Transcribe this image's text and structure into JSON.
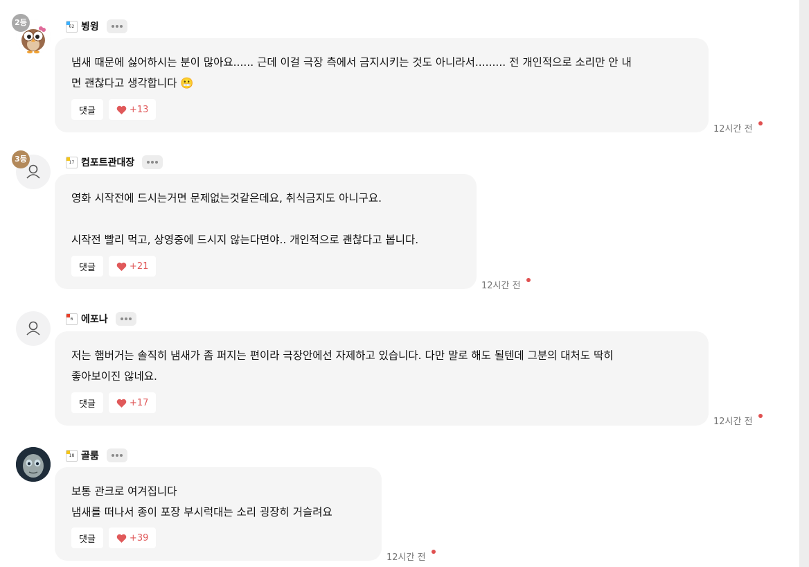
{
  "comments": [
    {
      "rank": "2등",
      "level": "62",
      "level_color": "#3ab0ff",
      "nickname": "뷩윙",
      "avatar": "owl-avatar",
      "text": "냄새 때문에 싫어하시는 분이 많아요...... 근데 이걸 극장 측에서 금지시키는 것도 아니라서......... 전 개인적으로 소리만 안 내\n면 괜찮다고 생각합니다 😬",
      "reply_label": "댓글",
      "likes": "+13",
      "time": "12시간 전"
    },
    {
      "rank": "3등",
      "level": "17",
      "level_color": "#f5c518",
      "nickname": "컴포트관대장",
      "avatar": "default-user-avatar",
      "text": "영화 시작전에 드시는거면 문제없는것같은데요, 취식금지도 아니구요.\n\n시작전 빨리 먹고, 상영중에 드시지 않는다면야.. 개인적으로 괜찮다고 봅니다.",
      "reply_label": "댓글",
      "likes": "+21",
      "time": "12시간 전"
    },
    {
      "level": "6",
      "level_color": "#e8402a",
      "nickname": "에포나",
      "avatar": "default-user-avatar",
      "text": "저는 햄버거는 솔직히 냄새가 좀 퍼지는 편이라 극장안에선 자제하고 있습니다. 다만 말로 해도 될텐데 그분의 대처도 딱히\n좋아보이진 않네요.",
      "reply_label": "댓글",
      "likes": "+17",
      "time": "12시간 전"
    },
    {
      "level": "18",
      "level_color": "#f5c518",
      "nickname": "골룸",
      "avatar": "gollum-avatar",
      "text": "보통 관크로 여겨집니다\n냄새를 떠나서 종이 포장 부시럭대는 소리 굉장히 거슬려요",
      "reply_label": "댓글",
      "likes": "+39",
      "time": "12시간 전"
    }
  ],
  "colors": {
    "like": "#e0595a",
    "bubble": "#f5f5f5",
    "new_dot": "#e05050"
  }
}
